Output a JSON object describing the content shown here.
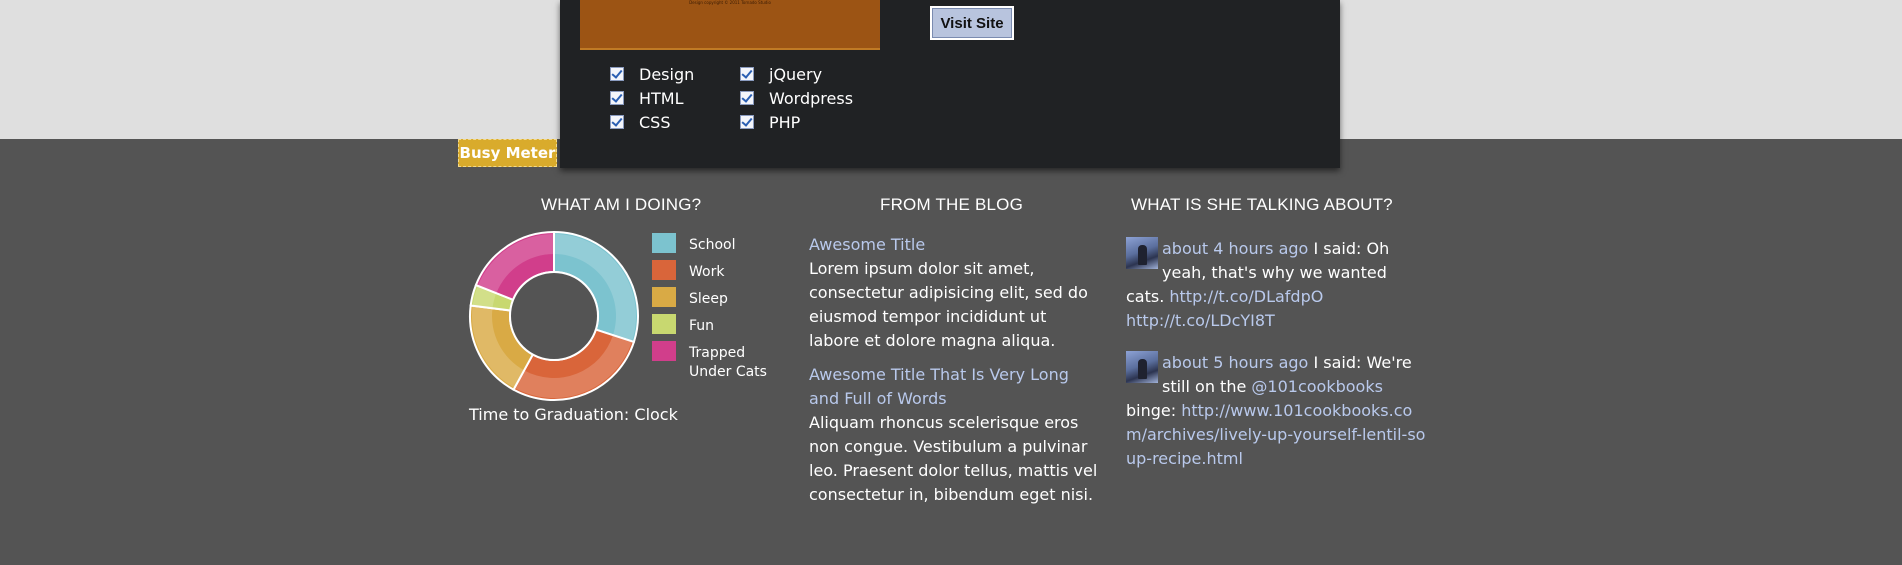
{
  "site_preview": {
    "caption": "Design copyright © 2011 Tornado Studio",
    "visit_button": "Visit Site"
  },
  "skills": {
    "left": [
      "Design",
      "HTML",
      "CSS"
    ],
    "right": [
      "jQuery",
      "Wordpress",
      "PHP"
    ]
  },
  "busy_meter": {
    "label": "Busy Meter"
  },
  "doing": {
    "title": "What am I doing?",
    "caption": "Time to Graduation: Clock",
    "legend": [
      {
        "label": "School",
        "color": "#7cc3cf"
      },
      {
        "label": "Work",
        "color": "#d9653a"
      },
      {
        "label": "Sleep",
        "color": "#d9aa45"
      },
      {
        "label": "Fun",
        "color": "#c8d870"
      },
      {
        "label": "Trapped Under Cats",
        "color": "#d13e8b"
      }
    ]
  },
  "chart_data": {
    "type": "pie",
    "categories": [
      "School",
      "Work",
      "Sleep",
      "Fun",
      "Trapped Under Cats"
    ],
    "values": [
      30,
      28,
      19,
      4,
      19
    ],
    "colors": [
      "#7cc3cf",
      "#d9653a",
      "#d9aa45",
      "#c8d870",
      "#d13e8b"
    ],
    "donut": true,
    "legend": "right"
  },
  "blog": {
    "title": "From the Blog",
    "posts": [
      {
        "title": "Awesome Title",
        "body": "Lorem ipsum dolor sit amet, consectetur adipisicing elit, sed do eiusmod tempor incididunt ut labore et dolore magna aliqua."
      },
      {
        "title": "Awesome Title That Is Very Long and Full of Words",
        "body": "Aliquam rhoncus scelerisque eros non congue. Vestibulum a pulvinar leo. Praesent dolor tellus, mattis vel consectetur in, bibendum eget nisi."
      }
    ]
  },
  "talking": {
    "title": "What is she talking about?",
    "tweets": [
      {
        "time": "about 4 hours ago",
        "said": "I said:",
        "text": "Oh yeah, that's why we wanted cats.",
        "link1": "http://t.co/DLafdpO",
        "link2": "http://t.co/LDcYI8T"
      },
      {
        "time": "about 5 hours ago",
        "said": "I said:",
        "text_before": "We're still on the",
        "mention": "@101cookbooks",
        "text_after": "binge:",
        "link": "http://www.101cookbooks.com/archives/lively-up-yourself-lentil-soup-recipe.html"
      }
    ]
  }
}
